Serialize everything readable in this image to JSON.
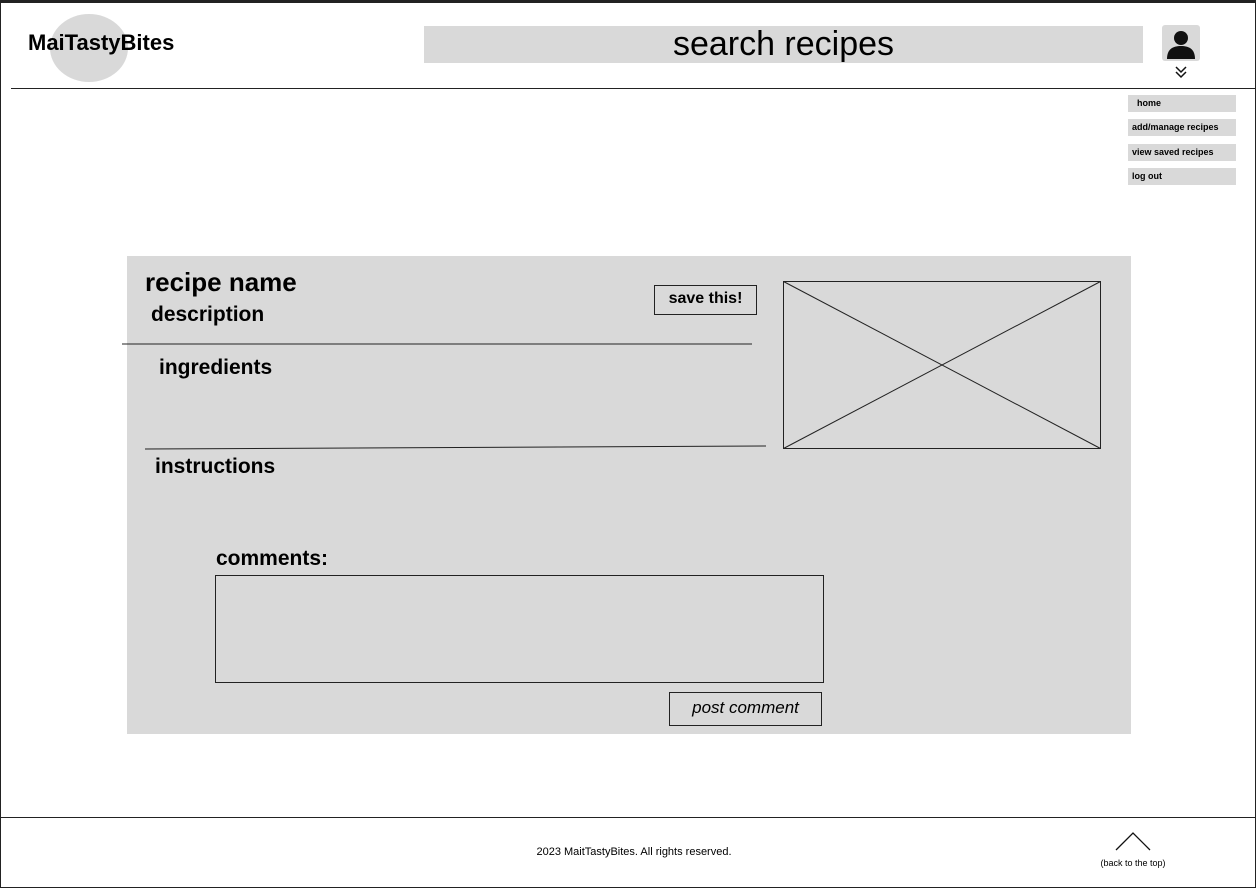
{
  "header": {
    "logo_text": "MaiTastyBites",
    "search_placeholder": "search recipes"
  },
  "menu": {
    "items": [
      {
        "label": "home"
      },
      {
        "label": "add/manage recipes"
      },
      {
        "label": "view saved recipes"
      },
      {
        "label": "log out"
      }
    ]
  },
  "recipe": {
    "name": "recipe name",
    "description": "description",
    "save_label": "save this!",
    "ingredients_heading": "ingredients",
    "instructions_heading": "instructions"
  },
  "comments": {
    "heading": "comments:",
    "post_label": "post comment"
  },
  "footer": {
    "copyright": "2023 MaitTastyBites. All rights reserved.",
    "back_to_top": "(back to the top)"
  },
  "colors": {
    "placeholder_gray": "#d9d9d9",
    "line": "#222222"
  },
  "icons": {
    "profile": "user-icon",
    "dropdown": "double-chevron-down-icon",
    "back_to_top": "chevron-up-icon"
  }
}
